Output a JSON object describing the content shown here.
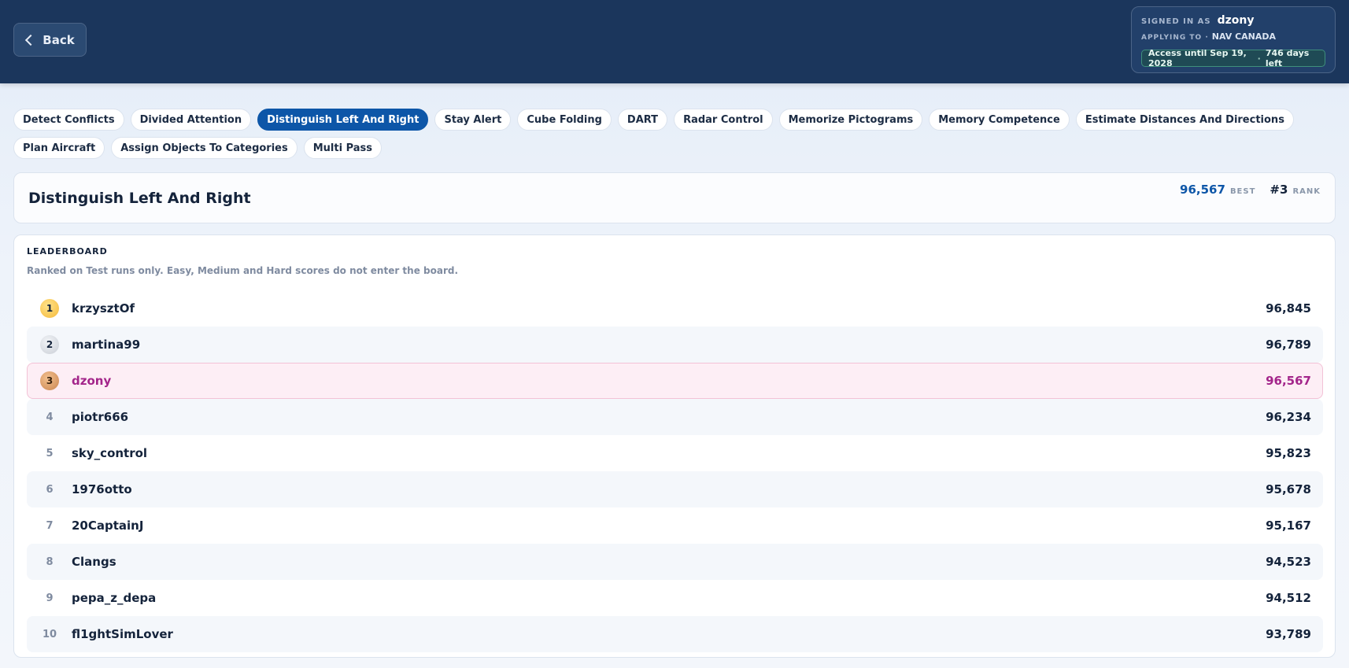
{
  "header": {
    "back_label": "Back",
    "signed_in_label": "SIGNED IN AS",
    "username": "dzony",
    "applying_label": "APPLYING TO ·",
    "organization": "NAV CANADA",
    "access_text": "Access until Sep 19, 2028",
    "access_sep": "·",
    "days_left": "746 days left"
  },
  "tabs": [
    {
      "label": "Detect Conflicts"
    },
    {
      "label": "Divided Attention"
    },
    {
      "label": "Distinguish Left And Right",
      "active": true
    },
    {
      "label": "Stay Alert"
    },
    {
      "label": "Cube Folding"
    },
    {
      "label": "DART"
    },
    {
      "label": "Radar Control"
    },
    {
      "label": "Memorize Pictograms"
    },
    {
      "label": "Memory Competence"
    },
    {
      "label": "Estimate Distances And Directions"
    },
    {
      "label": "Plan Aircraft"
    },
    {
      "label": "Assign Objects To Categories"
    },
    {
      "label": "Multi Pass"
    }
  ],
  "summary": {
    "title": "Distinguish Left And Right",
    "best_value": "96,567",
    "best_label": "BEST",
    "rank_value": "#3",
    "rank_label": "RANK"
  },
  "leaderboard": {
    "title": "LEADERBOARD",
    "subtitle": "Ranked on Test runs only. Easy, Medium and Hard scores do not enter the board.",
    "rows": [
      {
        "rank": "1",
        "name": "krzysztOf",
        "score": "96,845",
        "medal": "gold"
      },
      {
        "rank": "2",
        "name": "martina99",
        "score": "96,789",
        "medal": "silver"
      },
      {
        "rank": "3",
        "name": "dzony",
        "score": "96,567",
        "medal": "bronze",
        "is_me": true
      },
      {
        "rank": "4",
        "name": "piotr666",
        "score": "96,234"
      },
      {
        "rank": "5",
        "name": "sky_control",
        "score": "95,823"
      },
      {
        "rank": "6",
        "name": "1976otto",
        "score": "95,678"
      },
      {
        "rank": "7",
        "name": "20CaptainJ",
        "score": "95,167"
      },
      {
        "rank": "8",
        "name": "Clangs",
        "score": "94,523"
      },
      {
        "rank": "9",
        "name": "pepa_z_depa",
        "score": "94,512"
      },
      {
        "rank": "10",
        "name": "fl1ghtSimLover",
        "score": "93,789"
      }
    ]
  },
  "colors": {
    "header_bg": "#1b365c",
    "accent": "#0d56a8",
    "highlight_name": "#a3258a"
  }
}
